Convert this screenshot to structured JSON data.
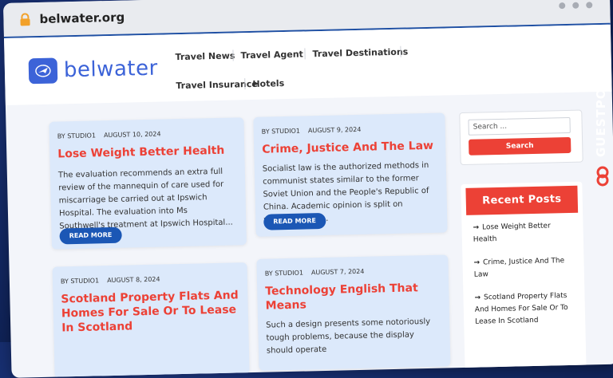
{
  "browser": {
    "url": "belwater.org"
  },
  "site": {
    "logo_text": "belwater"
  },
  "nav": [
    "Travel News",
    "Travel Agent",
    "Travel Destinations",
    "Travel Insurance",
    "Hotels"
  ],
  "posts": [
    {
      "author": "BY STUDIO1",
      "date": "AUGUST 10, 2024",
      "title": "Lose Weight Better Health",
      "excerpt": "The evaluation recommends an extra full review of the mannequin of care used for miscarriage be carried out at Ipswich Hospital. The evaluation into Ms Southwell's treatment at Ipswich Hospital...",
      "button": "READ MORE"
    },
    {
      "author": "BY STUDIO1",
      "date": "AUGUST 9, 2024",
      "title": "Crime, Justice And The Law",
      "excerpt": "Socialist law is the authorized methods in communist states similar to the former Soviet Union and the People's Republic of China. Academic opinion is split on whether it is a...",
      "button": "READ MORE"
    },
    {
      "author": "BY STUDIO1",
      "date": "AUGUST 8, 2024",
      "title": "Scotland Property Flats And Homes For Sale Or To Lease In Scotland",
      "excerpt": "",
      "button": ""
    },
    {
      "author": "BY STUDIO1",
      "date": "AUGUST 7, 2024",
      "title": "Technology English That Means",
      "excerpt": "Such a design presents some notoriously tough problems, because the display should operate",
      "button": ""
    }
  ],
  "search": {
    "placeholder": "Search ...",
    "button": "Search"
  },
  "recent_posts": {
    "title": "Recent Posts",
    "items": [
      "Lose Weight Better Health",
      "Crime, Justice And The Law",
      "Scotland Property Flats And Homes For Sale Or To Lease In Scotland"
    ]
  },
  "watermark": {
    "text": "GUESTPOSTLINKS"
  },
  "colors": {
    "accent_red": "#ec4136",
    "brand_blue": "#3c63d8",
    "button_blue": "#1b57b5",
    "card_bg": "#dce9fb"
  }
}
